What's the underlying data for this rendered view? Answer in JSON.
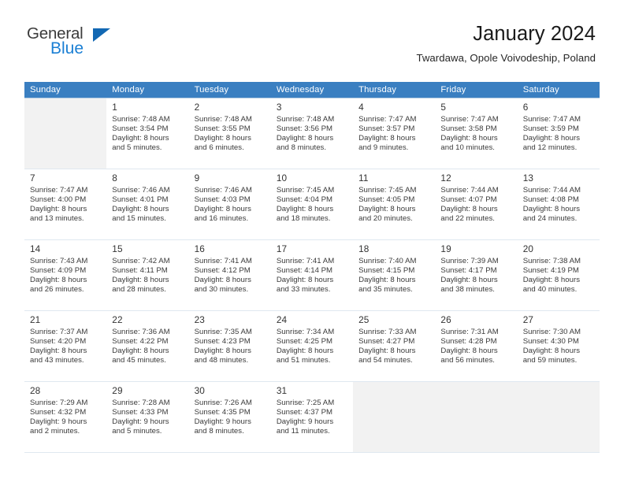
{
  "brand": {
    "name_part1": "General",
    "name_part2": "Blue",
    "triangle_icon": "blue-triangle-icon",
    "accent_color": "#1a7fd4",
    "triangle_color": "#1268b3"
  },
  "header": {
    "title": "January 2024",
    "subtitle": "Twardawa, Opole Voivodeship, Poland"
  },
  "calendar": {
    "header_bg_color": "#3a7fc1",
    "header_text_color": "#ffffff",
    "shaded_cell_color": "#f2f2f2",
    "weekday_headers": [
      "Sunday",
      "Monday",
      "Tuesday",
      "Wednesday",
      "Thursday",
      "Friday",
      "Saturday"
    ],
    "labels": {
      "sunrise": "Sunrise:",
      "sunset": "Sunset:",
      "daylight": "Daylight:"
    },
    "weeks": [
      [
        {
          "day": "",
          "sunrise": "",
          "sunset": "",
          "daylight_line1": "",
          "daylight_line2": "",
          "empty": true,
          "shaded": true
        },
        {
          "day": "1",
          "sunrise": "Sunrise: 7:48 AM",
          "sunset": "Sunset: 3:54 PM",
          "daylight_line1": "Daylight: 8 hours",
          "daylight_line2": "and 5 minutes.",
          "empty": false,
          "shaded": false
        },
        {
          "day": "2",
          "sunrise": "Sunrise: 7:48 AM",
          "sunset": "Sunset: 3:55 PM",
          "daylight_line1": "Daylight: 8 hours",
          "daylight_line2": "and 6 minutes.",
          "empty": false,
          "shaded": false
        },
        {
          "day": "3",
          "sunrise": "Sunrise: 7:48 AM",
          "sunset": "Sunset: 3:56 PM",
          "daylight_line1": "Daylight: 8 hours",
          "daylight_line2": "and 8 minutes.",
          "empty": false,
          "shaded": false
        },
        {
          "day": "4",
          "sunrise": "Sunrise: 7:47 AM",
          "sunset": "Sunset: 3:57 PM",
          "daylight_line1": "Daylight: 8 hours",
          "daylight_line2": "and 9 minutes.",
          "empty": false,
          "shaded": false
        },
        {
          "day": "5",
          "sunrise": "Sunrise: 7:47 AM",
          "sunset": "Sunset: 3:58 PM",
          "daylight_line1": "Daylight: 8 hours",
          "daylight_line2": "and 10 minutes.",
          "empty": false,
          "shaded": false
        },
        {
          "day": "6",
          "sunrise": "Sunrise: 7:47 AM",
          "sunset": "Sunset: 3:59 PM",
          "daylight_line1": "Daylight: 8 hours",
          "daylight_line2": "and 12 minutes.",
          "empty": false,
          "shaded": false
        }
      ],
      [
        {
          "day": "7",
          "sunrise": "Sunrise: 7:47 AM",
          "sunset": "Sunset: 4:00 PM",
          "daylight_line1": "Daylight: 8 hours",
          "daylight_line2": "and 13 minutes.",
          "empty": false,
          "shaded": false
        },
        {
          "day": "8",
          "sunrise": "Sunrise: 7:46 AM",
          "sunset": "Sunset: 4:01 PM",
          "daylight_line1": "Daylight: 8 hours",
          "daylight_line2": "and 15 minutes.",
          "empty": false,
          "shaded": false
        },
        {
          "day": "9",
          "sunrise": "Sunrise: 7:46 AM",
          "sunset": "Sunset: 4:03 PM",
          "daylight_line1": "Daylight: 8 hours",
          "daylight_line2": "and 16 minutes.",
          "empty": false,
          "shaded": false
        },
        {
          "day": "10",
          "sunrise": "Sunrise: 7:45 AM",
          "sunset": "Sunset: 4:04 PM",
          "daylight_line1": "Daylight: 8 hours",
          "daylight_line2": "and 18 minutes.",
          "empty": false,
          "shaded": false
        },
        {
          "day": "11",
          "sunrise": "Sunrise: 7:45 AM",
          "sunset": "Sunset: 4:05 PM",
          "daylight_line1": "Daylight: 8 hours",
          "daylight_line2": "and 20 minutes.",
          "empty": false,
          "shaded": false
        },
        {
          "day": "12",
          "sunrise": "Sunrise: 7:44 AM",
          "sunset": "Sunset: 4:07 PM",
          "daylight_line1": "Daylight: 8 hours",
          "daylight_line2": "and 22 minutes.",
          "empty": false,
          "shaded": false
        },
        {
          "day": "13",
          "sunrise": "Sunrise: 7:44 AM",
          "sunset": "Sunset: 4:08 PM",
          "daylight_line1": "Daylight: 8 hours",
          "daylight_line2": "and 24 minutes.",
          "empty": false,
          "shaded": false
        }
      ],
      [
        {
          "day": "14",
          "sunrise": "Sunrise: 7:43 AM",
          "sunset": "Sunset: 4:09 PM",
          "daylight_line1": "Daylight: 8 hours",
          "daylight_line2": "and 26 minutes.",
          "empty": false,
          "shaded": false
        },
        {
          "day": "15",
          "sunrise": "Sunrise: 7:42 AM",
          "sunset": "Sunset: 4:11 PM",
          "daylight_line1": "Daylight: 8 hours",
          "daylight_line2": "and 28 minutes.",
          "empty": false,
          "shaded": false
        },
        {
          "day": "16",
          "sunrise": "Sunrise: 7:41 AM",
          "sunset": "Sunset: 4:12 PM",
          "daylight_line1": "Daylight: 8 hours",
          "daylight_line2": "and 30 minutes.",
          "empty": false,
          "shaded": false
        },
        {
          "day": "17",
          "sunrise": "Sunrise: 7:41 AM",
          "sunset": "Sunset: 4:14 PM",
          "daylight_line1": "Daylight: 8 hours",
          "daylight_line2": "and 33 minutes.",
          "empty": false,
          "shaded": false
        },
        {
          "day": "18",
          "sunrise": "Sunrise: 7:40 AM",
          "sunset": "Sunset: 4:15 PM",
          "daylight_line1": "Daylight: 8 hours",
          "daylight_line2": "and 35 minutes.",
          "empty": false,
          "shaded": false
        },
        {
          "day": "19",
          "sunrise": "Sunrise: 7:39 AM",
          "sunset": "Sunset: 4:17 PM",
          "daylight_line1": "Daylight: 8 hours",
          "daylight_line2": "and 38 minutes.",
          "empty": false,
          "shaded": false
        },
        {
          "day": "20",
          "sunrise": "Sunrise: 7:38 AM",
          "sunset": "Sunset: 4:19 PM",
          "daylight_line1": "Daylight: 8 hours",
          "daylight_line2": "and 40 minutes.",
          "empty": false,
          "shaded": false
        }
      ],
      [
        {
          "day": "21",
          "sunrise": "Sunrise: 7:37 AM",
          "sunset": "Sunset: 4:20 PM",
          "daylight_line1": "Daylight: 8 hours",
          "daylight_line2": "and 43 minutes.",
          "empty": false,
          "shaded": false
        },
        {
          "day": "22",
          "sunrise": "Sunrise: 7:36 AM",
          "sunset": "Sunset: 4:22 PM",
          "daylight_line1": "Daylight: 8 hours",
          "daylight_line2": "and 45 minutes.",
          "empty": false,
          "shaded": false
        },
        {
          "day": "23",
          "sunrise": "Sunrise: 7:35 AM",
          "sunset": "Sunset: 4:23 PM",
          "daylight_line1": "Daylight: 8 hours",
          "daylight_line2": "and 48 minutes.",
          "empty": false,
          "shaded": false
        },
        {
          "day": "24",
          "sunrise": "Sunrise: 7:34 AM",
          "sunset": "Sunset: 4:25 PM",
          "daylight_line1": "Daylight: 8 hours",
          "daylight_line2": "and 51 minutes.",
          "empty": false,
          "shaded": false
        },
        {
          "day": "25",
          "sunrise": "Sunrise: 7:33 AM",
          "sunset": "Sunset: 4:27 PM",
          "daylight_line1": "Daylight: 8 hours",
          "daylight_line2": "and 54 minutes.",
          "empty": false,
          "shaded": false
        },
        {
          "day": "26",
          "sunrise": "Sunrise: 7:31 AM",
          "sunset": "Sunset: 4:28 PM",
          "daylight_line1": "Daylight: 8 hours",
          "daylight_line2": "and 56 minutes.",
          "empty": false,
          "shaded": false
        },
        {
          "day": "27",
          "sunrise": "Sunrise: 7:30 AM",
          "sunset": "Sunset: 4:30 PM",
          "daylight_line1": "Daylight: 8 hours",
          "daylight_line2": "and 59 minutes.",
          "empty": false,
          "shaded": false
        }
      ],
      [
        {
          "day": "28",
          "sunrise": "Sunrise: 7:29 AM",
          "sunset": "Sunset: 4:32 PM",
          "daylight_line1": "Daylight: 9 hours",
          "daylight_line2": "and 2 minutes.",
          "empty": false,
          "shaded": false
        },
        {
          "day": "29",
          "sunrise": "Sunrise: 7:28 AM",
          "sunset": "Sunset: 4:33 PM",
          "daylight_line1": "Daylight: 9 hours",
          "daylight_line2": "and 5 minutes.",
          "empty": false,
          "shaded": false
        },
        {
          "day": "30",
          "sunrise": "Sunrise: 7:26 AM",
          "sunset": "Sunset: 4:35 PM",
          "daylight_line1": "Daylight: 9 hours",
          "daylight_line2": "and 8 minutes.",
          "empty": false,
          "shaded": false
        },
        {
          "day": "31",
          "sunrise": "Sunrise: 7:25 AM",
          "sunset": "Sunset: 4:37 PM",
          "daylight_line1": "Daylight: 9 hours",
          "daylight_line2": "and 11 minutes.",
          "empty": false,
          "shaded": false
        },
        {
          "day": "",
          "sunrise": "",
          "sunset": "",
          "daylight_line1": "",
          "daylight_line2": "",
          "empty": true,
          "shaded": true
        },
        {
          "day": "",
          "sunrise": "",
          "sunset": "",
          "daylight_line1": "",
          "daylight_line2": "",
          "empty": true,
          "shaded": true
        },
        {
          "day": "",
          "sunrise": "",
          "sunset": "",
          "daylight_line1": "",
          "daylight_line2": "",
          "empty": true,
          "shaded": true
        }
      ]
    ]
  }
}
